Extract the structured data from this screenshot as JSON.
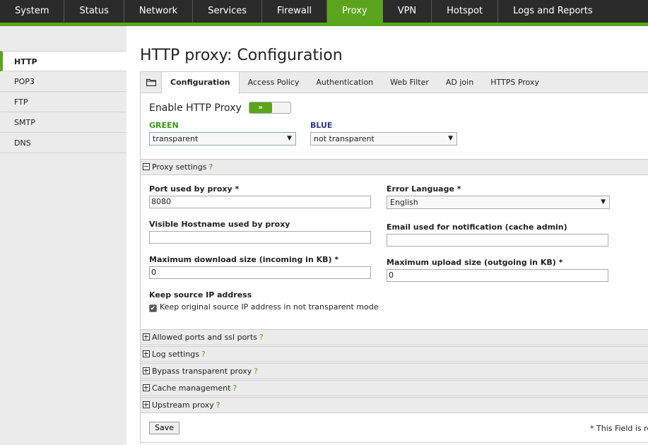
{
  "topnav": {
    "tabs": [
      {
        "label": "System"
      },
      {
        "label": "Status"
      },
      {
        "label": "Network"
      },
      {
        "label": "Services"
      },
      {
        "label": "Firewall"
      },
      {
        "label": "Proxy"
      },
      {
        "label": "VPN"
      },
      {
        "label": "Hotspot"
      },
      {
        "label": "Logs and Reports"
      }
    ],
    "active": "Proxy"
  },
  "sidebar": {
    "items": [
      {
        "label": "HTTP"
      },
      {
        "label": "POP3"
      },
      {
        "label": "FTP"
      },
      {
        "label": "SMTP"
      },
      {
        "label": "DNS"
      }
    ],
    "active": "HTTP"
  },
  "page": {
    "title": "HTTP proxy: Configuration"
  },
  "subtabs": [
    {
      "label": "Configuration"
    },
    {
      "label": "Access Policy"
    },
    {
      "label": "Authentication"
    },
    {
      "label": "Web Filter"
    },
    {
      "label": "AD join"
    },
    {
      "label": "HTTPS Proxy"
    }
  ],
  "enable": {
    "label": "Enable HTTP Proxy",
    "toggle_glyph": "»",
    "state": "on"
  },
  "interfaces": {
    "green": {
      "label": "GREEN",
      "value": "transparent"
    },
    "blue": {
      "label": "BLUE",
      "value": "not transparent"
    }
  },
  "proxy_settings": {
    "header": "Proxy settings",
    "port_label": "Port used by proxy *",
    "port_value": "8080",
    "error_lang_label": "Error Language *",
    "error_lang_value": "English",
    "hostname_label": "Visible Hostname used by proxy",
    "hostname_value": "",
    "email_label": "Email used for notification (cache admin)",
    "email_value": "",
    "max_download_label": "Maximum download size (incoming in KB) *",
    "max_download_value": "0",
    "max_upload_label": "Maximum upload size (outgoing in KB) *",
    "max_upload_value": "0",
    "keep_source_label": "Keep source IP address",
    "keep_source_checkbox_label": "Keep original source IP address in not transparent mode",
    "keep_source_checked": true
  },
  "collapsed_sections": [
    {
      "label": "Allowed ports and ssl ports"
    },
    {
      "label": "Log settings"
    },
    {
      "label": "Bypass transparent proxy"
    },
    {
      "label": "Cache management"
    },
    {
      "label": "Upstream proxy"
    }
  ],
  "help_glyph": "?",
  "save_label": "Save",
  "required_note": "* This Field is required.",
  "colors": {
    "accent": "#5aa51b",
    "green_label": "#3a9a1a",
    "blue_label": "#2a3a8a",
    "nav_bg": "#2b2b2b"
  }
}
